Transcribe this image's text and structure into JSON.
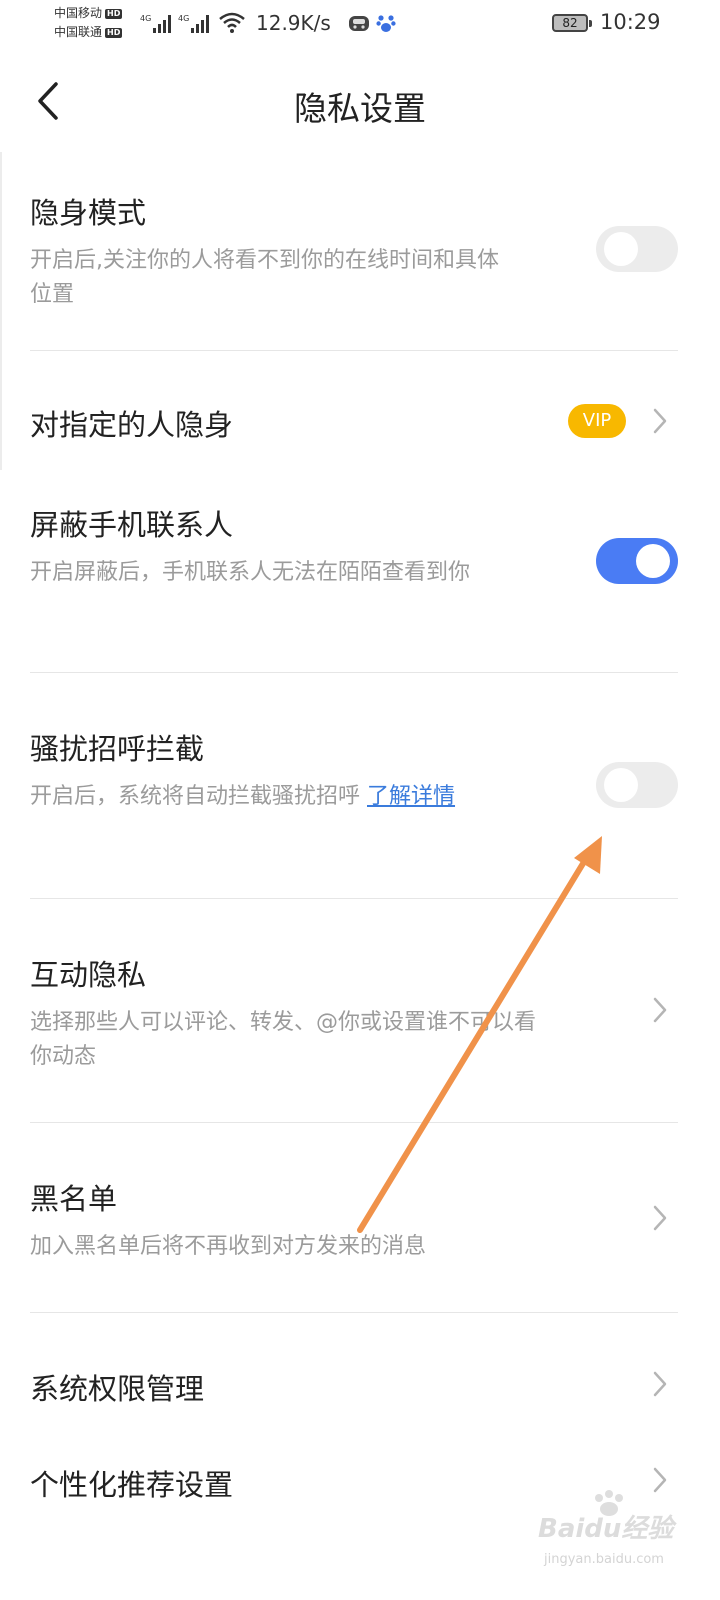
{
  "status_bar": {
    "carrier_1": "中国移动",
    "carrier_2": "中国联通",
    "hd_badge": "HD",
    "network_type": "4G",
    "net_speed": "12.9K/s",
    "battery_level": "82",
    "time": "10:29"
  },
  "header": {
    "title": "隐私设置",
    "back_icon": "chevron-left-icon"
  },
  "settings": {
    "invisible_mode": {
      "title": "隐身模式",
      "description": "开启后,关注你的人将看不到你的在线时间和具体位置",
      "enabled": false
    },
    "hide_from_specific": {
      "title": "对指定的人隐身",
      "badge": "VIP"
    },
    "block_contacts": {
      "title": "屏蔽手机联系人",
      "description": "开启屏蔽后，手机联系人无法在陌陌查看到你",
      "enabled": true
    },
    "harassment_block": {
      "title": "骚扰招呼拦截",
      "description": "开启后，系统将自动拦截骚扰招呼 ",
      "link": "了解详情",
      "enabled": false
    },
    "interaction_privacy": {
      "title": "互动隐私",
      "description": "选择那些人可以评论、转发、@你或设置谁不可以看你动态"
    },
    "blacklist": {
      "title": "黑名单",
      "description": "加入黑名单后将不再收到对方发来的消息"
    },
    "system_permissions": {
      "title": "系统权限管理"
    },
    "personalized_recommendation": {
      "title": "个性化推荐设置"
    }
  },
  "watermark": {
    "brand": "Baidu经验",
    "url": "jingyan.baidu.com"
  },
  "colors": {
    "toggle_on": "#4a7cf4",
    "toggle_off": "#ececec",
    "vip": "#f8b800",
    "link": "#3a7bdc",
    "annotation_arrow": "#f0924a"
  }
}
